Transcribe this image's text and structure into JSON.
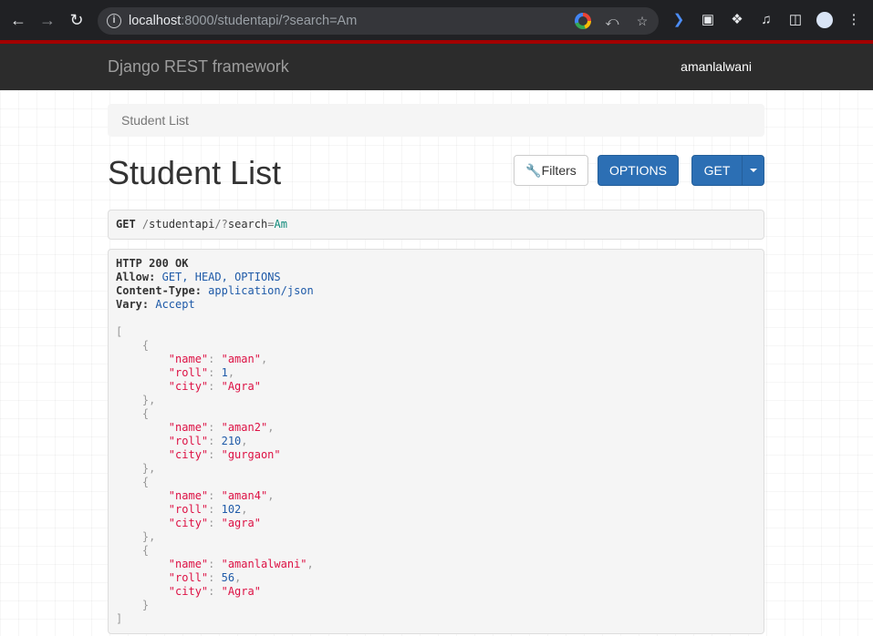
{
  "browser": {
    "url_host": "localhost",
    "url_rest": ":8000/studentapi/?search=Am",
    "back_icon": "arrow-left-icon",
    "forward_icon": "arrow-right-icon",
    "reload_icon": "reload-icon"
  },
  "navbar": {
    "brand": "Django REST framework",
    "user": "amanlalwani"
  },
  "breadcrumb": {
    "item": "Student List"
  },
  "header": {
    "title": "Student List",
    "filters_label": "Filters",
    "options_label": "OPTIONS",
    "get_label": "GET"
  },
  "request": {
    "method": "GET",
    "path_slash1": "/",
    "path_seg": "studentapi",
    "path_slash2": "/",
    "query_mark": "?",
    "query_key": "search",
    "query_eq": "=",
    "query_val": "Am"
  },
  "response": {
    "status": "HTTP 200 OK",
    "allow_key": "Allow:",
    "allow_val": "GET, HEAD, OPTIONS",
    "ctype_key": "Content-Type:",
    "ctype_val": "application/json",
    "vary_key": "Vary:",
    "vary_val": "Accept",
    "students": [
      {
        "name": "\"aman\"",
        "roll": "1",
        "city": "\"Agra\""
      },
      {
        "name": "\"aman2\"",
        "roll": "210",
        "city": "\"gurgaon\""
      },
      {
        "name": "\"aman4\"",
        "roll": "102",
        "city": "\"agra\""
      },
      {
        "name": "\"amanlalwani\"",
        "roll": "56",
        "city": "\"Agra\""
      }
    ],
    "key_name": "\"name\"",
    "key_roll": "\"roll\"",
    "key_city": "\"city\""
  }
}
